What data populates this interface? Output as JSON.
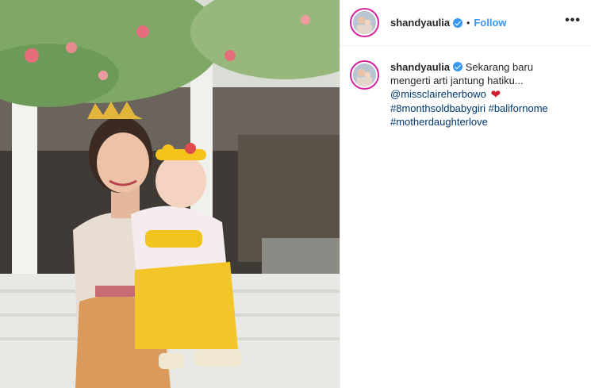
{
  "post": {
    "username": "shandyaulia",
    "separator": "•",
    "follow_label": "Follow",
    "more_label": "•••",
    "caption": {
      "text_line1": "Sekarang baru",
      "text_line2": "mengerti arti jantung hatiku...",
      "mention": "@missclaireherbowo",
      "heart": "❤",
      "hashtag1": "#8monthsoldbabygiri",
      "hashtag2": "#balifornome",
      "hashtag3": "#motherdaughterlove"
    }
  },
  "icons": {
    "verified": "verified-badge-icon",
    "more": "more-options-icon",
    "heart": "red-heart-emoji"
  },
  "colors": {
    "link": "#3897f0",
    "mention": "#00376b",
    "heart": "#d01f2f",
    "avatar_ring": "#d6249f"
  }
}
